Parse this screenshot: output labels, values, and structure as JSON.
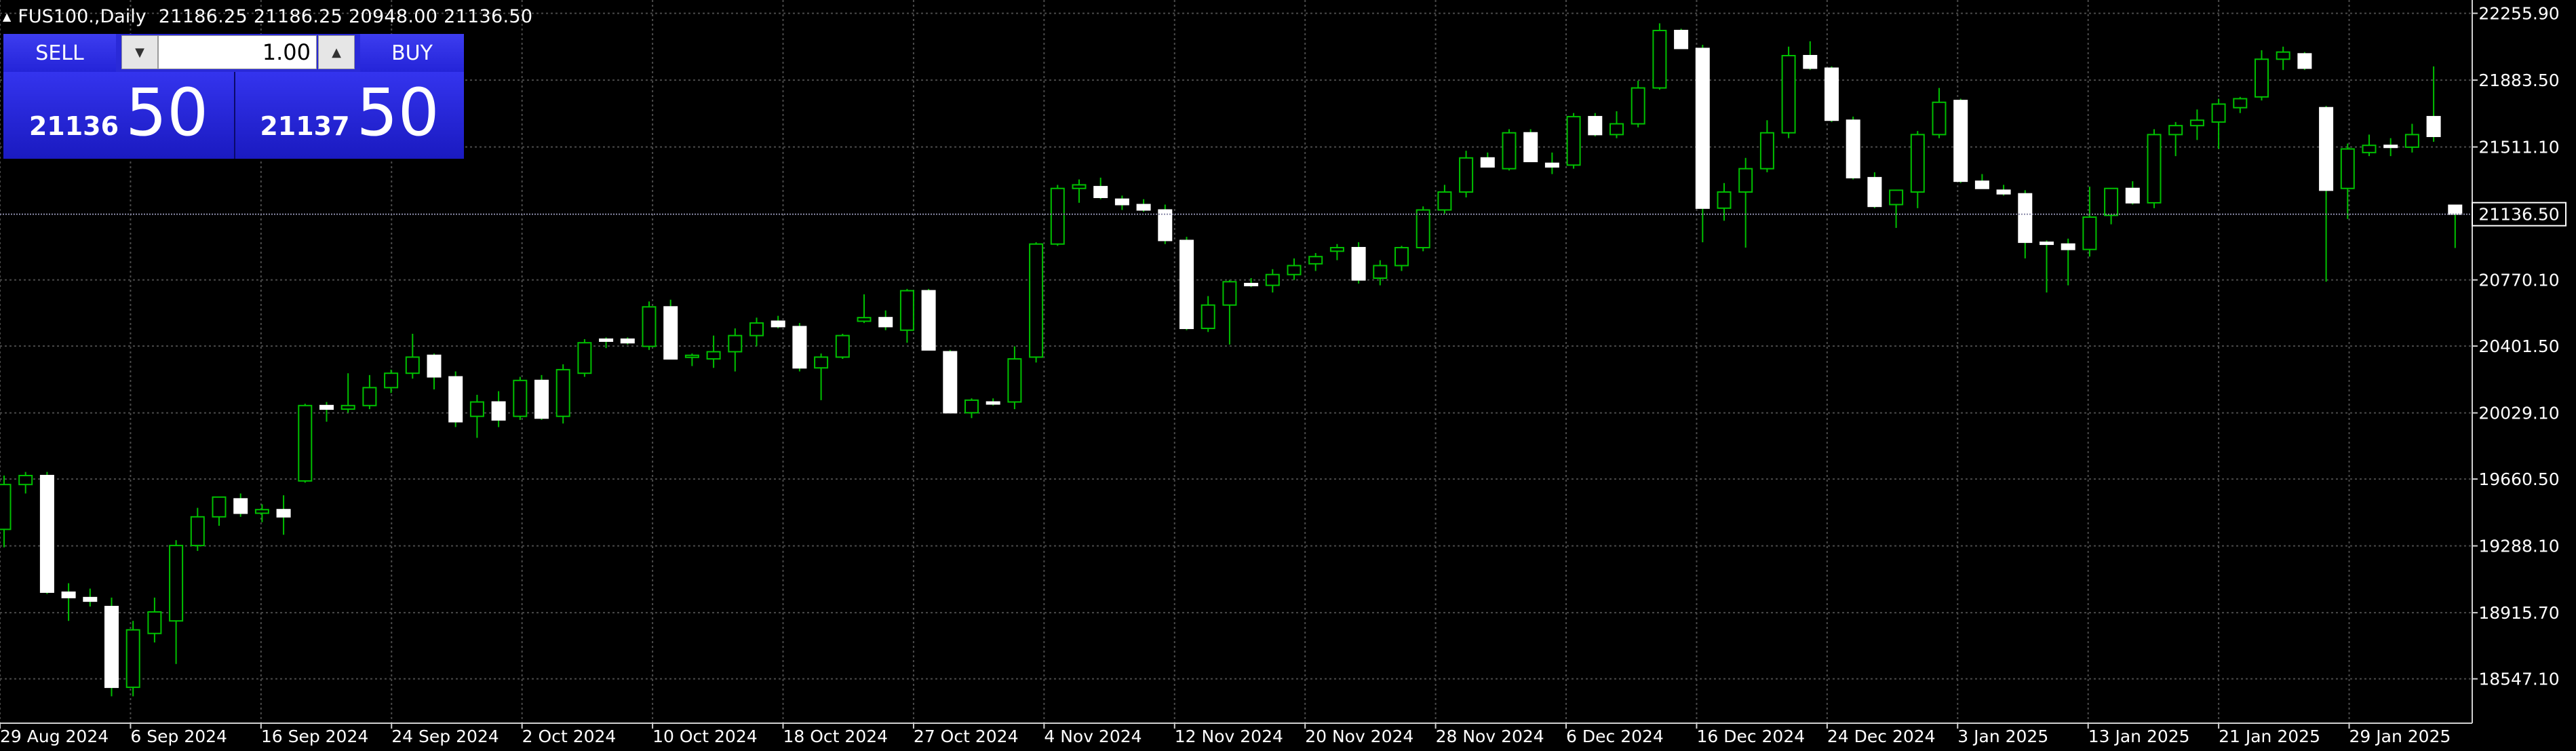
{
  "header": {
    "symbol": "FUS100.,Daily",
    "ohlc": "21186.25 21186.25 20948.00 21136.50"
  },
  "trade_panel": {
    "sell_label": "SELL",
    "buy_label": "BUY",
    "lot_value": "1.00",
    "sell_big": "21136",
    "sell_points": "50",
    "buy_big": "21137",
    "buy_points": "50"
  },
  "colors": {
    "background": "#000000",
    "grid": "#555555",
    "candle_up": "#00c000",
    "candle_body_down": "#ffffff",
    "price_line": "#8a8aa8",
    "panel_blue": "#2a2ad8"
  },
  "chart_data": {
    "type": "candlestick",
    "symbol": "FUS100.",
    "timeframe": "Daily",
    "ylim": [
      18300,
      22330
    ],
    "y_ticks": [
      22255.9,
      21883.5,
      21511.1,
      21136.5,
      20770.1,
      20401.5,
      20029.1,
      19660.5,
      19288.1,
      18915.7,
      18547.1
    ],
    "current_price": 21136.5,
    "current_price_label": "21136.50",
    "x_labels": [
      "29 Aug 2024",
      "6 Sep 2024",
      "16 Sep 2024",
      "24 Sep 2024",
      "2 Oct 2024",
      "10 Oct 2024",
      "18 Oct 2024",
      "27 Oct 2024",
      "4 Nov 2024",
      "12 Nov 2024",
      "20 Nov 2024",
      "28 Nov 2024",
      "6 Dec 2024",
      "16 Dec 2024",
      "24 Dec 2024",
      "3 Jan 2025",
      "13 Jan 2025",
      "21 Jan 2025",
      "29 Jan 2025"
    ],
    "candles": [
      [
        19380,
        19680,
        19280,
        19630
      ],
      [
        19630,
        19700,
        19580,
        19680
      ],
      [
        19680,
        19700,
        19020,
        19030
      ],
      [
        19030,
        19080,
        18870,
        19000
      ],
      [
        19000,
        19050,
        18950,
        18980
      ],
      [
        18950,
        19000,
        18450,
        18500
      ],
      [
        18500,
        18870,
        18450,
        18820
      ],
      [
        18800,
        19000,
        18750,
        18920
      ],
      [
        18870,
        19320,
        18630,
        19290
      ],
      [
        19290,
        19500,
        19260,
        19450
      ],
      [
        19450,
        19560,
        19400,
        19560
      ],
      [
        19550,
        19580,
        19450,
        19470
      ],
      [
        19470,
        19520,
        19420,
        19490
      ],
      [
        19490,
        19570,
        19350,
        19450
      ],
      [
        19650,
        20080,
        19640,
        20070
      ],
      [
        20070,
        20090,
        19980,
        20050
      ],
      [
        20050,
        20250,
        20030,
        20070
      ],
      [
        20070,
        20240,
        20050,
        20170
      ],
      [
        20170,
        20270,
        20140,
        20250
      ],
      [
        20250,
        20470,
        20220,
        20340
      ],
      [
        20350,
        20360,
        20160,
        20230
      ],
      [
        20230,
        20260,
        19950,
        19980
      ],
      [
        20010,
        20130,
        19890,
        20090
      ],
      [
        20090,
        20150,
        19950,
        19990
      ],
      [
        20010,
        20230,
        19990,
        20210
      ],
      [
        20210,
        20240,
        19990,
        20000
      ],
      [
        20010,
        20300,
        19970,
        20270
      ],
      [
        20250,
        20440,
        20230,
        20420
      ],
      [
        20440,
        20450,
        20390,
        20430
      ],
      [
        20440,
        20450,
        20410,
        20420
      ],
      [
        20400,
        20650,
        20380,
        20620
      ],
      [
        20620,
        20660,
        20330,
        20330
      ],
      [
        20340,
        20360,
        20290,
        20350
      ],
      [
        20330,
        20460,
        20280,
        20370
      ],
      [
        20370,
        20500,
        20260,
        20460
      ],
      [
        20460,
        20560,
        20400,
        20530
      ],
      [
        20540,
        20570,
        20500,
        20510
      ],
      [
        20510,
        20530,
        20260,
        20280
      ],
      [
        20280,
        20360,
        20100,
        20340
      ],
      [
        20340,
        20470,
        20330,
        20460
      ],
      [
        20540,
        20690,
        20530,
        20560
      ],
      [
        20560,
        20600,
        20490,
        20510
      ],
      [
        20490,
        20720,
        20420,
        20710
      ],
      [
        20710,
        20720,
        20380,
        20380
      ],
      [
        20370,
        20380,
        20040,
        20030
      ],
      [
        20030,
        20110,
        20000,
        20100
      ],
      [
        20090,
        20110,
        20070,
        20080
      ],
      [
        20090,
        20400,
        20050,
        20330
      ],
      [
        20340,
        20980,
        20310,
        20970
      ],
      [
        20970,
        21300,
        20960,
        21280
      ],
      [
        21280,
        21330,
        21200,
        21300
      ],
      [
        21290,
        21340,
        21220,
        21230
      ],
      [
        21220,
        21240,
        21160,
        21190
      ],
      [
        21190,
        21220,
        21150,
        21160
      ],
      [
        21160,
        21190,
        20970,
        20990
      ],
      [
        20990,
        21010,
        20490,
        20500
      ],
      [
        20500,
        20680,
        20480,
        20630
      ],
      [
        20630,
        20770,
        20410,
        20760
      ],
      [
        20750,
        20780,
        20730,
        20740
      ],
      [
        20740,
        20830,
        20700,
        20800
      ],
      [
        20800,
        20890,
        20770,
        20850
      ],
      [
        20860,
        20920,
        20820,
        20900
      ],
      [
        20930,
        20970,
        20880,
        20950
      ],
      [
        20950,
        20980,
        20750,
        20770
      ],
      [
        20780,
        20880,
        20740,
        20850
      ],
      [
        20850,
        20960,
        20820,
        20950
      ],
      [
        20950,
        21180,
        20930,
        21160
      ],
      [
        21160,
        21300,
        21140,
        21260
      ],
      [
        21260,
        21490,
        21230,
        21450
      ],
      [
        21450,
        21480,
        21400,
        21400
      ],
      [
        21390,
        21610,
        21380,
        21590
      ],
      [
        21590,
        21610,
        21430,
        21430
      ],
      [
        21420,
        21480,
        21360,
        21400
      ],
      [
        21410,
        21700,
        21390,
        21680
      ],
      [
        21680,
        21700,
        21570,
        21580
      ],
      [
        21580,
        21710,
        21560,
        21640
      ],
      [
        21640,
        21880,
        21620,
        21840
      ],
      [
        21840,
        22200,
        21830,
        22160
      ],
      [
        22160,
        22170,
        22060,
        22060
      ],
      [
        22060,
        22080,
        20980,
        21170
      ],
      [
        21170,
        21310,
        21100,
        21260
      ],
      [
        21260,
        21450,
        20950,
        21390
      ],
      [
        21390,
        21660,
        21370,
        21590
      ],
      [
        21590,
        22070,
        21560,
        22020
      ],
      [
        22020,
        22100,
        21940,
        21950
      ],
      [
        21950,
        21960,
        21650,
        21660
      ],
      [
        21660,
        21680,
        21330,
        21340
      ],
      [
        21340,
        21370,
        21170,
        21180
      ],
      [
        21190,
        21250,
        21060,
        21270
      ],
      [
        21260,
        21600,
        21170,
        21580
      ],
      [
        21580,
        21840,
        21560,
        21760
      ],
      [
        21770,
        21780,
        21310,
        21320
      ],
      [
        21320,
        21360,
        21280,
        21280
      ],
      [
        21270,
        21300,
        21240,
        21250
      ],
      [
        21250,
        21270,
        20890,
        20980
      ],
      [
        20980,
        20990,
        20700,
        20970
      ],
      [
        20970,
        21000,
        20740,
        20940
      ],
      [
        20940,
        21290,
        20900,
        21120
      ],
      [
        21130,
        21280,
        21080,
        21280
      ],
      [
        21280,
        21320,
        21190,
        21200
      ],
      [
        21200,
        21610,
        21170,
        21580
      ],
      [
        21580,
        21650,
        21460,
        21630
      ],
      [
        21630,
        21720,
        21550,
        21660
      ],
      [
        21650,
        21780,
        21500,
        21750
      ],
      [
        21730,
        21790,
        21700,
        21780
      ],
      [
        21790,
        22050,
        21770,
        22000
      ],
      [
        22000,
        22070,
        21940,
        22040
      ],
      [
        22030,
        22040,
        21940,
        21950
      ],
      [
        21730,
        21740,
        20760,
        21270
      ],
      [
        21280,
        21530,
        21110,
        21500
      ],
      [
        21480,
        21580,
        21460,
        21520
      ],
      [
        21520,
        21560,
        21460,
        21510
      ],
      [
        21510,
        21640,
        21480,
        21580
      ],
      [
        21680,
        21960,
        21540,
        21570
      ],
      [
        21186.25,
        21186.25,
        20948.0,
        21136.5
      ]
    ]
  }
}
